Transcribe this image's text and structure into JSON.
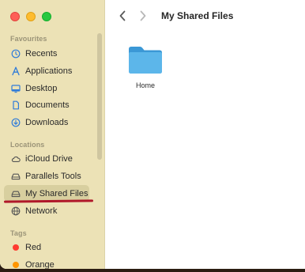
{
  "window": {
    "title": "My Shared Files"
  },
  "sidebar": {
    "favourites_label": "Favourites",
    "favourites": [
      {
        "label": "Recents",
        "icon": "clock-icon"
      },
      {
        "label": "Applications",
        "icon": "applications-icon"
      },
      {
        "label": "Desktop",
        "icon": "desktop-icon"
      },
      {
        "label": "Documents",
        "icon": "document-icon"
      },
      {
        "label": "Downloads",
        "icon": "download-icon"
      }
    ],
    "locations_label": "Locations",
    "locations": [
      {
        "label": "iCloud Drive",
        "icon": "cloud-icon"
      },
      {
        "label": "Parallels Tools",
        "icon": "drive-icon"
      },
      {
        "label": "My Shared Files",
        "icon": "drive-icon",
        "selected": true
      },
      {
        "label": "Network",
        "icon": "globe-icon"
      }
    ],
    "tags_label": "Tags",
    "tags": [
      {
        "label": "Red",
        "color": "#ff3b30"
      },
      {
        "label": "Orange",
        "color": "#ff9500"
      }
    ]
  },
  "content": {
    "items": [
      {
        "label": "Home",
        "icon": "folder-icon",
        "color": "#4aa5de"
      }
    ]
  },
  "colors": {
    "sidebar_bg": "#ece2b6",
    "selection_bg": "#d8cf9f",
    "annotation_underline": "#b0182a",
    "folder_blue": "#4aa5de"
  }
}
